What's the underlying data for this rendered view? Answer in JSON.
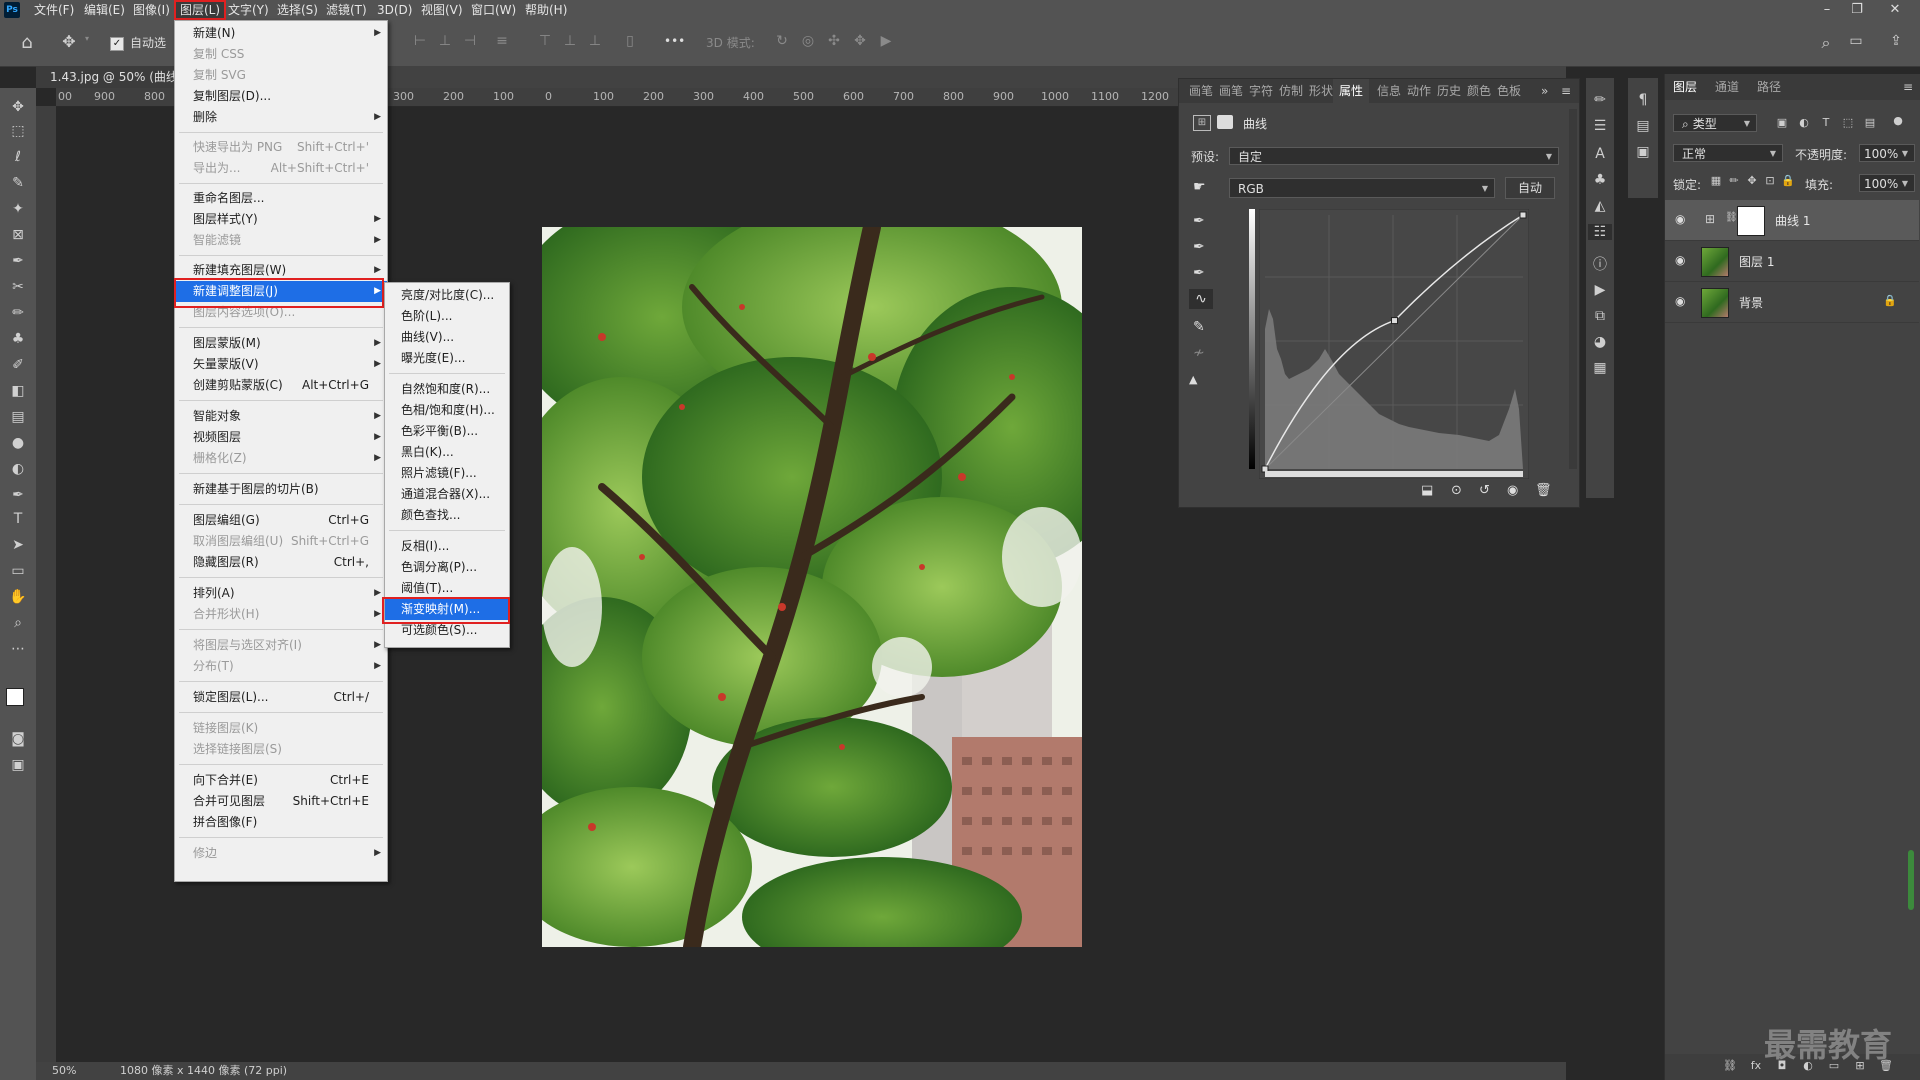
{
  "app": {
    "logo": "Ps"
  },
  "menubar": {
    "items": [
      "文件(F)",
      "编辑(E)",
      "图像(I)",
      "图层(L)",
      "文字(Y)",
      "选择(S)",
      "滤镜(T)",
      "3D(D)",
      "视图(V)",
      "窗口(W)",
      "帮助(H)"
    ],
    "active_index": 3
  },
  "window_controls": {
    "minimize": "–",
    "restore": "❐",
    "close": "✕"
  },
  "options_bar": {
    "auto_select_label": "自动选",
    "mode_3d_label": "3D 模式:",
    "more": "•••"
  },
  "document": {
    "tab_title": "1.43.jpg @ 50% (曲线",
    "zoom": "50%",
    "status": "1080 像素 x 1440 像素 (72 ppi)"
  },
  "ruler": {
    "h_ticks": [
      "00",
      "900",
      "800",
      "300",
      "200",
      "100",
      "0",
      "100",
      "200",
      "300",
      "400",
      "500",
      "600",
      "700",
      "800",
      "900",
      "1000",
      "1100",
      "1200"
    ]
  },
  "layer_menu": {
    "items": [
      {
        "label": "新建(N)",
        "shortcut": "",
        "submenu": true,
        "disabled": false
      },
      {
        "label": "复制 CSS",
        "shortcut": "",
        "submenu": false,
        "disabled": true
      },
      {
        "label": "复制 SVG",
        "shortcut": "",
        "submenu": false,
        "disabled": true
      },
      {
        "label": "复制图层(D)...",
        "shortcut": "",
        "submenu": false,
        "disabled": false
      },
      {
        "label": "删除",
        "shortcut": "",
        "submenu": true,
        "disabled": false
      },
      {
        "label": "快速导出为 PNG",
        "shortcut": "Shift+Ctrl+'",
        "submenu": false,
        "disabled": true
      },
      {
        "label": "导出为...",
        "shortcut": "Alt+Shift+Ctrl+'",
        "submenu": false,
        "disabled": true
      },
      {
        "label": "重命名图层...",
        "shortcut": "",
        "submenu": false,
        "disabled": false
      },
      {
        "label": "图层样式(Y)",
        "shortcut": "",
        "submenu": true,
        "disabled": false
      },
      {
        "label": "智能滤镜",
        "shortcut": "",
        "submenu": true,
        "disabled": true
      },
      {
        "label": "新建填充图层(W)",
        "shortcut": "",
        "submenu": true,
        "disabled": false
      },
      {
        "label": "新建调整图层(J)",
        "shortcut": "",
        "submenu": true,
        "disabled": false
      },
      {
        "label": "图层内容选项(O)...",
        "shortcut": "",
        "submenu": false,
        "disabled": true
      },
      {
        "label": "图层蒙版(M)",
        "shortcut": "",
        "submenu": true,
        "disabled": false
      },
      {
        "label": "矢量蒙版(V)",
        "shortcut": "",
        "submenu": true,
        "disabled": false
      },
      {
        "label": "创建剪贴蒙版(C)",
        "shortcut": "Alt+Ctrl+G",
        "submenu": false,
        "disabled": false
      },
      {
        "label": "智能对象",
        "shortcut": "",
        "submenu": true,
        "disabled": false
      },
      {
        "label": "视频图层",
        "shortcut": "",
        "submenu": true,
        "disabled": false
      },
      {
        "label": "栅格化(Z)",
        "shortcut": "",
        "submenu": true,
        "disabled": true
      },
      {
        "label": "新建基于图层的切片(B)",
        "shortcut": "",
        "submenu": false,
        "disabled": false
      },
      {
        "label": "图层编组(G)",
        "shortcut": "Ctrl+G",
        "submenu": false,
        "disabled": false
      },
      {
        "label": "取消图层编组(U)",
        "shortcut": "Shift+Ctrl+G",
        "submenu": false,
        "disabled": true
      },
      {
        "label": "隐藏图层(R)",
        "shortcut": "Ctrl+,",
        "submenu": false,
        "disabled": false
      },
      {
        "label": "排列(A)",
        "shortcut": "",
        "submenu": true,
        "disabled": false
      },
      {
        "label": "合并形状(H)",
        "shortcut": "",
        "submenu": true,
        "disabled": true
      },
      {
        "label": "将图层与选区对齐(I)",
        "shortcut": "",
        "submenu": true,
        "disabled": true
      },
      {
        "label": "分布(T)",
        "shortcut": "",
        "submenu": true,
        "disabled": true
      },
      {
        "label": "锁定图层(L)...",
        "shortcut": "Ctrl+/",
        "submenu": false,
        "disabled": false
      },
      {
        "label": "链接图层(K)",
        "shortcut": "",
        "submenu": false,
        "disabled": true
      },
      {
        "label": "选择链接图层(S)",
        "shortcut": "",
        "submenu": false,
        "disabled": true
      },
      {
        "label": "向下合并(E)",
        "shortcut": "Ctrl+E",
        "submenu": false,
        "disabled": false
      },
      {
        "label": "合并可见图层",
        "shortcut": "Shift+Ctrl+E",
        "submenu": false,
        "disabled": false
      },
      {
        "label": "拼合图像(F)",
        "shortcut": "",
        "submenu": false,
        "disabled": false
      },
      {
        "label": "修边",
        "shortcut": "",
        "submenu": true,
        "disabled": true
      }
    ],
    "highlighted_index": 11
  },
  "adjust_submenu": {
    "items": [
      "亮度/对比度(C)...",
      "色阶(L)...",
      "曲线(V)...",
      "曝光度(E)...",
      "自然饱和度(R)...",
      "色相/饱和度(H)...",
      "色彩平衡(B)...",
      "黑白(K)...",
      "照片滤镜(F)...",
      "通道混合器(X)...",
      "颜色查找...",
      "反相(I)...",
      "色调分离(P)...",
      "阈值(T)...",
      "渐变映射(M)...",
      "可选颜色(S)..."
    ],
    "highlighted_index": 14
  },
  "properties": {
    "tabs": [
      "画笔",
      "画笔",
      "字符",
      "仿制",
      "形状",
      "属性",
      "信息",
      "动作",
      "历史",
      "颜色",
      "色板"
    ],
    "active_tab_index": 5,
    "title": "曲线",
    "preset_label": "预设:",
    "preset_value": "自定",
    "channel_value": "RGB",
    "auto_button": "自动"
  },
  "curve": {
    "points": [
      [
        0,
        0
      ],
      [
        128,
        149
      ],
      [
        255,
        255
      ]
    ]
  },
  "layers_panel": {
    "tabs": [
      "图层",
      "通道",
      "路径"
    ],
    "active_tab_index": 0,
    "filter_label": "类型",
    "blend_mode": "正常",
    "opacity_label": "不透明度:",
    "opacity_value": "100%",
    "lock_label": "锁定:",
    "fill_label": "填充:",
    "fill_value": "100%",
    "layers": [
      {
        "name": "曲线 1",
        "type": "adjustment",
        "selected": true,
        "locked": false
      },
      {
        "name": "图层 1",
        "type": "image",
        "selected": false,
        "locked": false
      },
      {
        "name": "背景",
        "type": "image",
        "selected": false,
        "locked": true
      }
    ]
  },
  "watermark": "最需教育",
  "colors": {
    "highlight": "#1e6ee6",
    "annotation_red": "#e02020",
    "panel": "#434343",
    "menubar": "#535353"
  }
}
